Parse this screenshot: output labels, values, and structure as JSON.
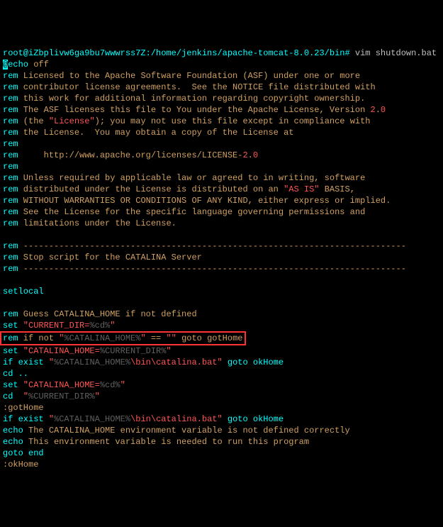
{
  "prompt": "root@iZbplivw6ga9bu7wwwrss7Z:/home/jenkins/apache-tomcat-8.0.23/bin# ",
  "command": "vim shutdown.bat",
  "lines": {
    "l1_cursor": "@",
    "l1_rest": "echo",
    "l1_off": " off",
    "rem": "rem",
    "l2": " Licensed to the Apache Software Foundation (ASF) under one or more",
    "l3": " contributor license agreements.  See the NOTICE file distributed with",
    "l4": " this work for additional information regarding copyright ownership.",
    "l5a": " The ASF licenses this file to You under the Apache License, Version ",
    "l5b": "2",
    "l5c": ".",
    "l5d": "0",
    "l6a": " (the ",
    "l6b": "\"License\"",
    "l6c": "); you may not use this file except in compliance with",
    "l7": " the License.  You may obtain a copy of the License at",
    "l9a": "     http://www.apache.org/licenses/LICENSE-",
    "l9b": "2",
    "l9c": ".",
    "l9d": "0",
    "l11a": " Unless required by applicable law or agreed to in writing, software",
    "l12a": " distributed under the License is distributed on an ",
    "l12b": "\"AS IS\"",
    "l12c": " BASIS,",
    "l13": " WITHOUT WARRANTIES OR CONDITIONS OF ANY KIND, either express or implied.",
    "l14": " See the License for the specific language governing permissions and",
    "l15": " limitations under the License.",
    "dash": " ---------------------------------------------------------------------------",
    "l18": " Stop script for the CATALINA Server",
    "setlocal": "setlocal",
    "l22": " Guess CATALINA_HOME if not defined",
    "set": "set",
    "l23a": " \"CURRENT_DIR=",
    "l23b": "%cd%",
    "l23c": "\"",
    "hl_a": " if not ",
    "hl_b": "\"",
    "hl_c": "%CATALINA_HOME%",
    "hl_d": "\"",
    "hl_e": " == ",
    "hl_f": "\"\"",
    "hl_g": " goto gotHome",
    "l25a": " \"CATALINA_HOME=",
    "l25b": "%CURRENT_DIR%",
    "l25c": "\"",
    "if": "if",
    "exist": " exist ",
    "l26a": "\"",
    "l26b": "%CATALINA_HOME%",
    "l26c": "\\bin\\catalina.bat",
    "l26d": "\"",
    "l26e": " goto okHome",
    "cd": "cd",
    "cddots": " ..",
    "l28a": " \"CATALINA_HOME=",
    "l28b": "%cd%",
    "l28c": "\"",
    "l29a": "  ",
    "l29b": "\"",
    "l29c": "%CURRENT_DIR%",
    "l29d": "\"",
    "gotHome": ":gotHome",
    "echo": "echo",
    "l32": " The CATALINA_HOME environment variable is not defined correctly",
    "l33": " This environment variable is needed to run this program",
    "goto": "goto",
    "end": " end",
    "okHome": ":okHome"
  }
}
